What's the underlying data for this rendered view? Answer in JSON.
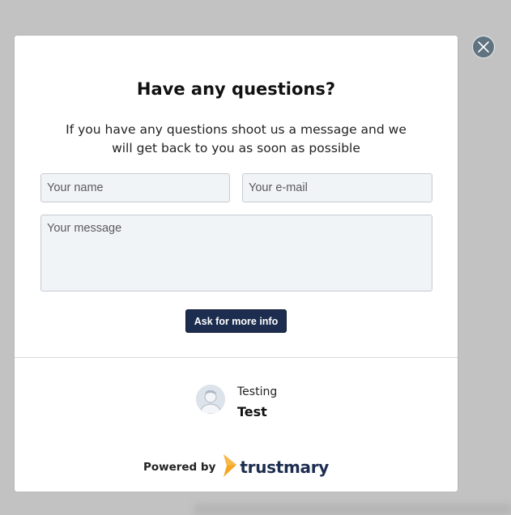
{
  "modal": {
    "title": "Have any questions?",
    "subtitle": "If you have any questions shoot us a message and we will get back to you as soon as possible"
  },
  "form": {
    "name_placeholder": "Your name",
    "email_placeholder": "Your e-mail",
    "message_placeholder": "Your message",
    "submit_label": "Ask for more info"
  },
  "reviewer": {
    "label": "Testing",
    "name": "Test"
  },
  "footer": {
    "powered_by": "Powered by",
    "brand": "trustmary"
  },
  "icons": {
    "close": "close-icon",
    "avatar": "user-avatar-icon",
    "brand_logo": "trustmary-logo-icon"
  },
  "colors": {
    "overlay": "#c2c2c2",
    "accent": "#1d2d4f",
    "brand_orange": "#f5a623",
    "close_button": "#5f7380"
  }
}
